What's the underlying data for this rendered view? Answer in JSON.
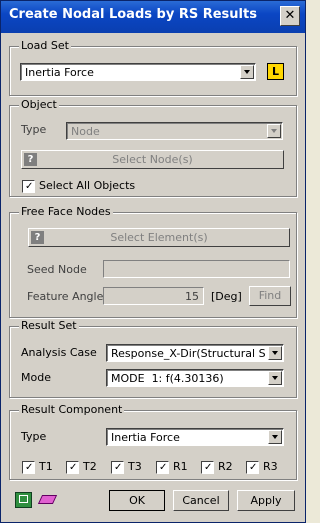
{
  "window": {
    "title": "Create Nodal Loads by RS Results",
    "close_glyph": "✕"
  },
  "load_set": {
    "group_title": "Load Set",
    "value": "Inertia Force",
    "icon_label": "L"
  },
  "object": {
    "group_title": "Object",
    "type_label": "Type",
    "type_value": "Node",
    "select_button": "Select Node(s)",
    "help_glyph": "?",
    "select_all_label": "Select All Objects",
    "select_all_checked": true
  },
  "free_face": {
    "group_title": "Free Face Nodes",
    "select_button": "Select Element(s)",
    "help_glyph": "?",
    "seed_label": "Seed Node",
    "seed_value": "",
    "feature_label": "Feature Angle",
    "feature_value": "15",
    "unit": "[Deg]",
    "find_button": "Find"
  },
  "result_set": {
    "group_title": "Result Set",
    "analysis_label": "Analysis Case",
    "analysis_value": "Response_X-Dir(Structural Spect",
    "mode_label": "Mode",
    "mode_value": "MODE  1: f(4.30136)"
  },
  "result_component": {
    "group_title": "Result Component",
    "type_label": "Type",
    "type_value": "Inertia Force",
    "checks": [
      {
        "label": "T1",
        "checked": true
      },
      {
        "label": "T2",
        "checked": true
      },
      {
        "label": "T3",
        "checked": true
      },
      {
        "label": "R1",
        "checked": true
      },
      {
        "label": "R2",
        "checked": true
      },
      {
        "label": "R3",
        "checked": true
      }
    ]
  },
  "footer": {
    "ok": "OK",
    "cancel": "Cancel",
    "apply": "Apply"
  },
  "check_glyph": "✓"
}
